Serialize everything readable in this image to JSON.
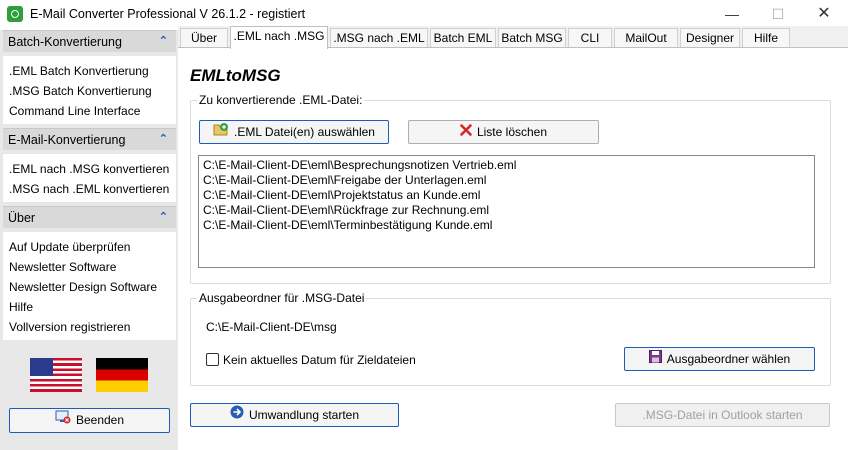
{
  "window": {
    "title": "E-Mail Converter Professional V 26.1.2 - registiert",
    "minimize": "—",
    "maximize": "☐",
    "close": "✕"
  },
  "sidebar": {
    "sections": [
      {
        "header": "Batch-Konvertierung",
        "items": [
          ".EML Batch Konvertierung",
          ".MSG Batch Konvertierung",
          "Command Line Interface"
        ]
      },
      {
        "header": "E-Mail-Konvertierung",
        "items": [
          ".EML nach .MSG konvertieren",
          ".MSG nach .EML konvertieren"
        ]
      },
      {
        "header": "Über",
        "items": [
          "Auf Update überprüfen",
          "Newsletter Software",
          "Newsletter Design Software",
          "Hilfe",
          "Vollversion registrieren"
        ]
      }
    ],
    "collapse_glyph": "⌃",
    "exit_button": "Beenden"
  },
  "tabs": [
    "Über",
    ".EML nach .MSG",
    ".MSG nach .EML",
    "Batch EML",
    "Batch MSG",
    "CLI",
    "MailOut",
    "Designer",
    "Hilfe"
  ],
  "active_tab_index": 1,
  "main": {
    "title": "EMLtoMSG",
    "input_group_label": "Zu konvertierende  .EML-Datei:",
    "select_button": ".EML Datei(en) auswählen",
    "clear_button": "Liste löschen",
    "files": [
      "C:\\E-Mail-Client-DE\\eml\\Besprechungsnotizen Vertrieb.eml",
      "C:\\E-Mail-Client-DE\\eml\\Freigabe der Unterlagen.eml",
      "C:\\E-Mail-Client-DE\\eml\\Projektstatus an Kunde.eml",
      "C:\\E-Mail-Client-DE\\eml\\Rückfrage zur Rechnung.eml",
      "C:\\E-Mail-Client-DE\\eml\\Terminbestätigung Kunde.eml"
    ],
    "output_group_label": "Ausgabeordner für .MSG-Datei",
    "output_path": "C:\\E-Mail-Client-DE\\msg",
    "no_date_checkbox_label": "Kein aktuelles Datum für Zieldateien",
    "no_date_checked": false,
    "choose_output_button": "Ausgabeordner wählen",
    "start_button": "Umwandlung starten",
    "outlook_button": ".MSG-Datei in Outlook starten"
  },
  "colors": {
    "accent": "#1e5bb8",
    "sidebar_bg": "#e8e8e8",
    "sidebar_header_bg": "#d9d9d9",
    "app_icon": "#2e9e3a",
    "delete_x": "#d12b2b"
  }
}
